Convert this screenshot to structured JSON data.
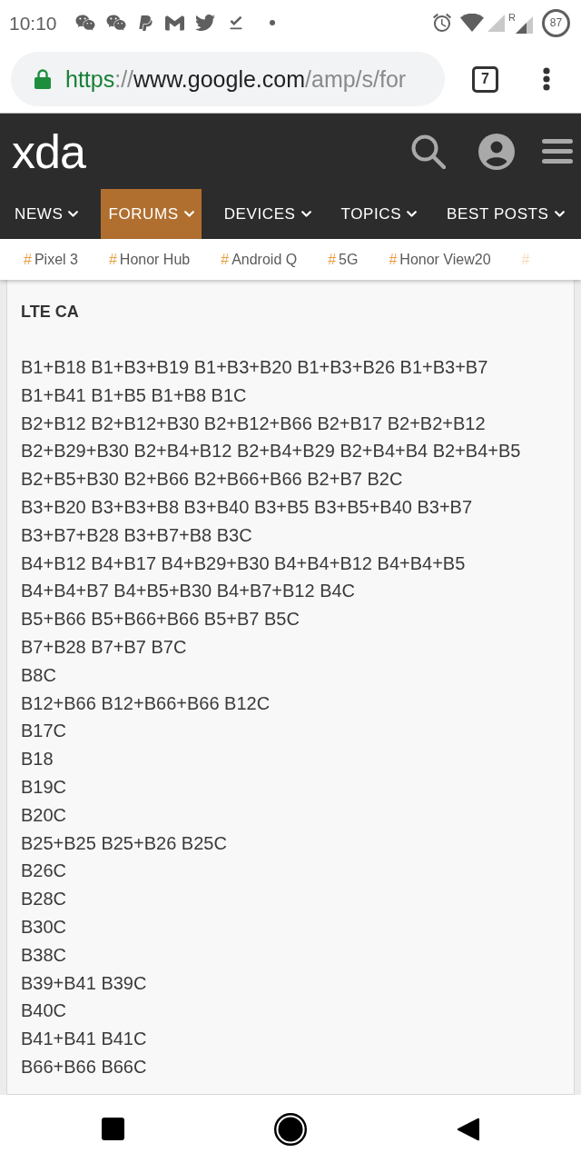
{
  "status_bar": {
    "time": "10:10",
    "roaming": "R",
    "battery": "87"
  },
  "address_bar": {
    "scheme": "https",
    "separator": "://",
    "host": "www.google.com",
    "path": "/amp/s/for",
    "tab_count": "7"
  },
  "site_header": {
    "logo": "xda"
  },
  "nav": [
    {
      "label": "NEWS",
      "selected": false
    },
    {
      "label": "FORUMS",
      "selected": true
    },
    {
      "label": "DEVICES",
      "selected": false
    },
    {
      "label": "TOPICS",
      "selected": false
    },
    {
      "label": "BEST POSTS",
      "selected": false
    }
  ],
  "tags": [
    {
      "hash": "#",
      "label": "Pixel 3"
    },
    {
      "hash": "#",
      "label": "Honor Hub"
    },
    {
      "hash": "#",
      "label": "Android Q"
    },
    {
      "hash": "#",
      "label": "5G"
    },
    {
      "hash": "#",
      "label": "Honor View20"
    },
    {
      "hash": "#"
    }
  ],
  "post": {
    "heading": "LTE CA",
    "lines": [
      "B1+B18 B1+B3+B19 B1+B3+B20 B1+B3+B26 B1+B3+B7",
      "B1+B41 B1+B5 B1+B8 B1C",
      "B2+B12 B2+B12+B30 B2+B12+B66 B2+B17 B2+B2+B12",
      "B2+B29+B30 B2+B4+B12 B2+B4+B29 B2+B4+B4 B2+B4+B5",
      "B2+B5+B30 B2+B66 B2+B66+B66 B2+B7 B2C",
      "B3+B20 B3+B3+B8 B3+B40 B3+B5 B3+B5+B40 B3+B7",
      "B3+B7+B28 B3+B7+B8 B3C",
      "B4+B12 B4+B17 B4+B29+B30 B4+B4+B12 B4+B4+B5",
      "B4+B4+B7 B4+B5+B30 B4+B7+B12 B4C",
      "B5+B66 B5+B66+B66 B5+B7 B5C",
      "B7+B28 B7+B7 B7C",
      "B8C",
      "B12+B66 B12+B66+B66 B12C",
      "B17C",
      "B18",
      "B19C",
      "B20C",
      "B25+B25 B25+B26 B25C",
      "B26C",
      "B28C",
      "B30C",
      "B38C",
      "B39+B41 B39C",
      "B40C",
      "B41+B41 B41C",
      "B66+B66 B66C"
    ]
  }
}
